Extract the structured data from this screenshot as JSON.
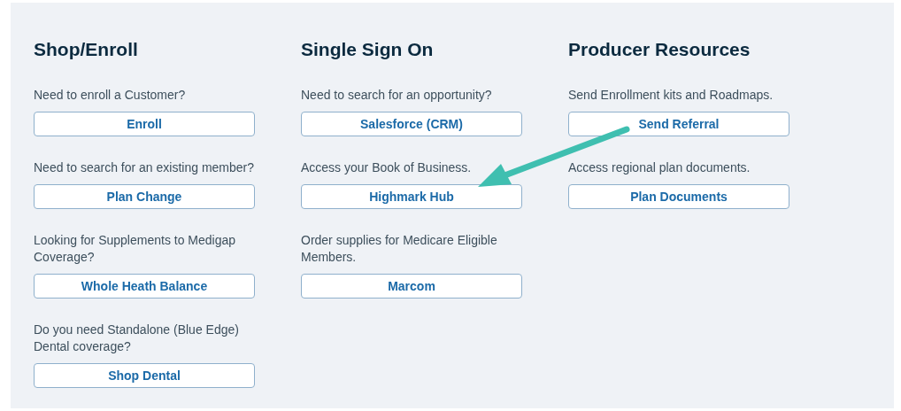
{
  "columns": [
    {
      "title": "Shop/Enroll",
      "items": [
        {
          "prompt": "Need to enroll a Customer?",
          "button": "Enroll"
        },
        {
          "prompt": "Need to search for an existing member?",
          "button": "Plan Change"
        },
        {
          "prompt": "Looking for Supplements to Medigap Coverage?",
          "button": "Whole Heath Balance"
        },
        {
          "prompt": "Do you need Standalone (Blue Edge) Dental coverage?",
          "button": "Shop Dental"
        }
      ]
    },
    {
      "title": "Single Sign On",
      "items": [
        {
          "prompt": "Need to search for an opportunity?",
          "button": "Salesforce (CRM)"
        },
        {
          "prompt": "Access your Book of Business.",
          "button": "Highmark Hub"
        },
        {
          "prompt": "Order supplies for Medicare Eligible Members.",
          "button": "Marcom"
        }
      ]
    },
    {
      "title": "Producer Resources",
      "items": [
        {
          "prompt": "Send Enrollment kits and Roadmaps.",
          "button": "Send Referral"
        },
        {
          "prompt": "Access regional plan documents.",
          "button": "Plan Documents"
        }
      ]
    }
  ]
}
